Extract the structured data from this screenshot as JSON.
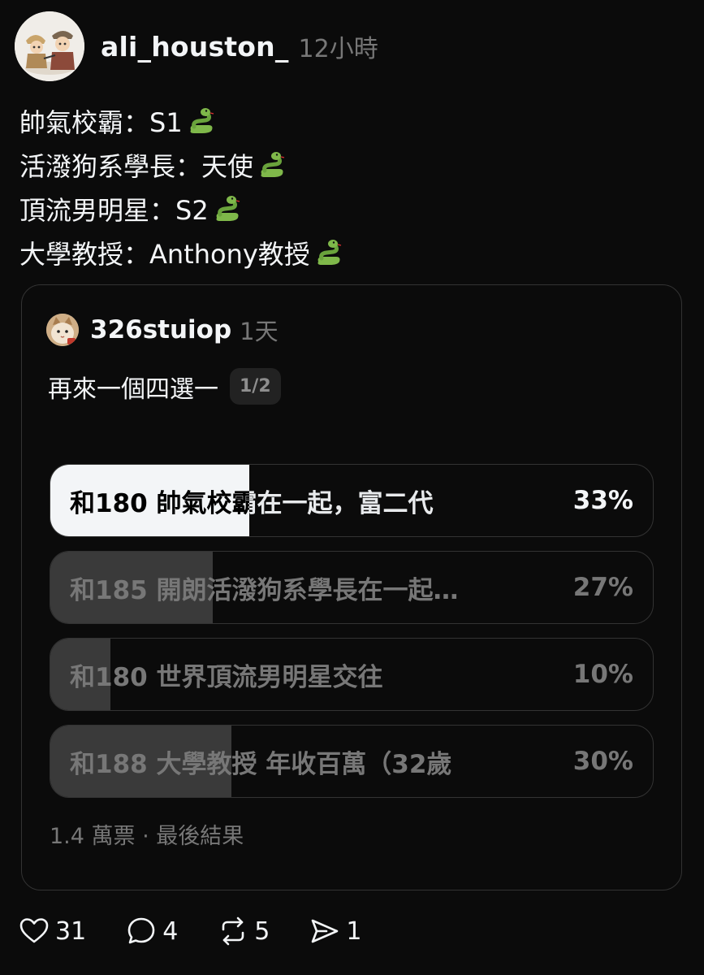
{
  "post": {
    "username": "ali_houston_",
    "time": "12小時",
    "lines": [
      {
        "text": "帥氣校霸：S1",
        "emoji": "snake"
      },
      {
        "text": "活潑狗系學長：天使",
        "emoji": "snake"
      },
      {
        "text": "頂流男明星：S2",
        "emoji": "snake"
      },
      {
        "text": "大學教授：Anthony教授",
        "emoji": "snake"
      }
    ]
  },
  "quote": {
    "username": "326stuiop",
    "time": "1天",
    "text": "再來一個四選一",
    "page_badge": "1/2",
    "poll": {
      "options": [
        {
          "label": "和180 帥氣校霸在一起，富二代",
          "percent_label": "33%",
          "percent": 33,
          "winner": true
        },
        {
          "label": "和185 開朗活潑狗系學長在一起…",
          "percent_label": "27%",
          "percent": 27,
          "winner": false
        },
        {
          "label": "和180 世界頂流男明星交往",
          "percent_label": "10%",
          "percent": 10,
          "winner": false
        },
        {
          "label": "和188 大學教授 年收百萬（32歲",
          "percent_label": "30%",
          "percent": 30,
          "winner": false
        }
      ],
      "footer": "1.4 萬票 · 最後結果"
    }
  },
  "actions": {
    "likes": "31",
    "comments": "4",
    "reposts": "5",
    "shares": "1"
  },
  "colors": {
    "background": "#0b0b0b",
    "text": "#f3f5f7",
    "muted": "#777777",
    "border": "#333333",
    "poll_fill": "#3a3a3a",
    "poll_winner_fill": "#f3f5f7",
    "snake_green": "#7fb84a"
  }
}
